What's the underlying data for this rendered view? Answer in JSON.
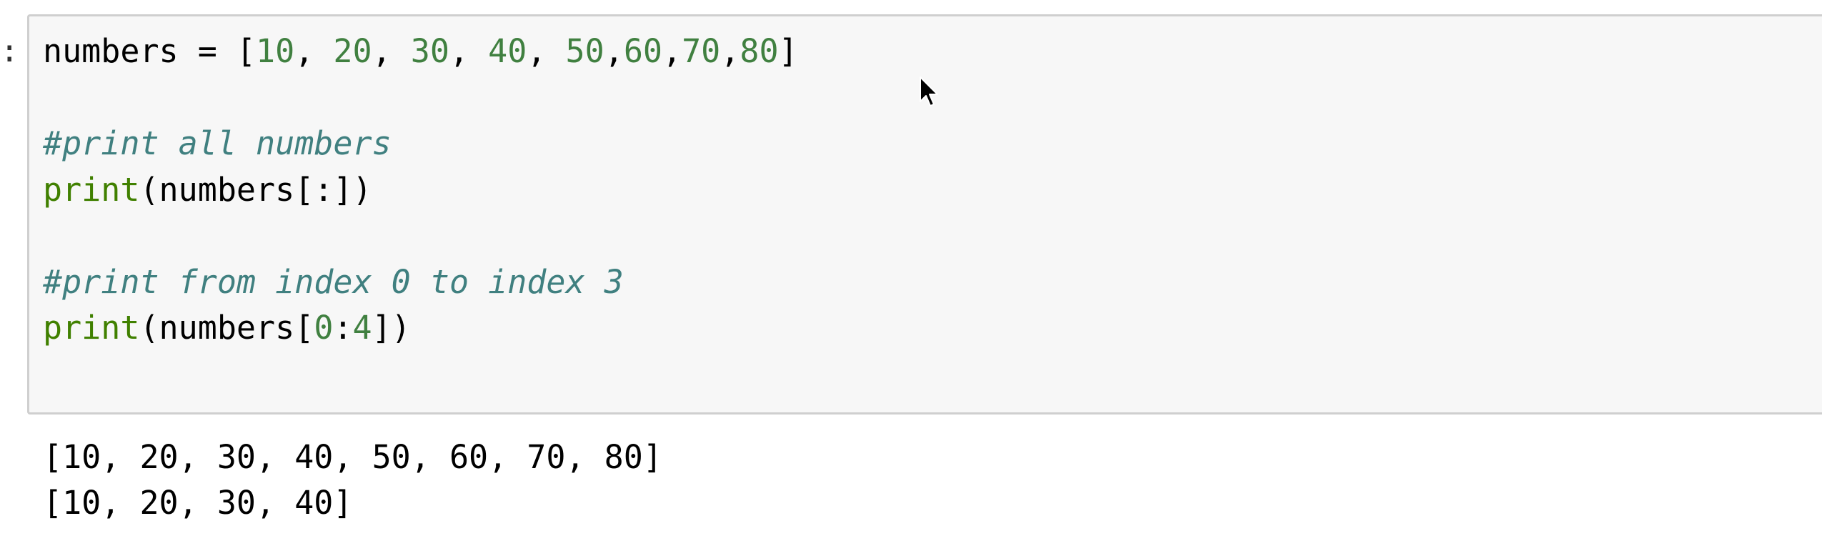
{
  "prompt_marker": ":",
  "code": {
    "line1": {
      "var": "numbers",
      "assign": " = [",
      "n1": "10",
      "s1": ", ",
      "n2": "20",
      "s2": ", ",
      "n3": "30",
      "s3": ", ",
      "n4": "40",
      "s4": ", ",
      "n5": "50",
      "s5": ",",
      "n6": "60",
      "s6": ",",
      "n7": "70",
      "s7": ",",
      "n8": "80",
      "close": "]"
    },
    "comment1": "#print all numbers",
    "line3": {
      "kw": "print",
      "rest": "(numbers[:])"
    },
    "comment2": "#print from index 0 to index 3",
    "line5": {
      "kw": "print",
      "pre": "(numbers[",
      "n1": "0",
      "colon": ":",
      "n2": "4",
      "post": "])"
    }
  },
  "output": {
    "line1": "[10, 20, 30, 40, 50, 60, 70, 80]",
    "line2": "[10, 20, 30, 40]"
  },
  "colors": {
    "number": "#408040",
    "keyword": "#408000",
    "comment": "#408080",
    "cell_background": "#f7f7f7",
    "cell_border": "#cfcfcf"
  },
  "icons": [
    "mouse-pointer-icon"
  ]
}
